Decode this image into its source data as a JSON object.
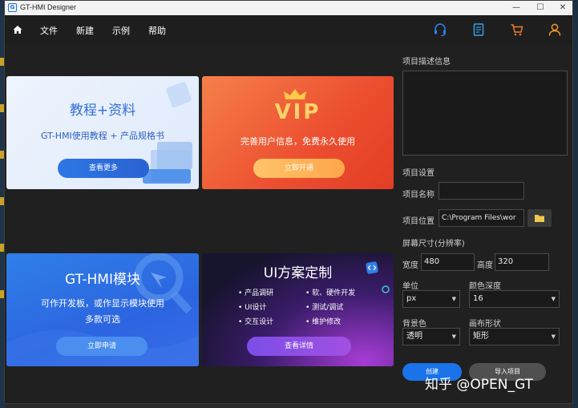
{
  "window": {
    "title": "GT-HMI Designer",
    "logo_text": "G"
  },
  "window_controls": {
    "minimize": "—",
    "maximize": "☐",
    "close": "✕"
  },
  "menu": {
    "home_icon": "home-icon",
    "items": [
      "文件",
      "新建",
      "示例",
      "帮助"
    ]
  },
  "toolbar_icons": [
    "headset-icon",
    "document-icon",
    "cart-icon",
    "user-icon"
  ],
  "cards": {
    "tutorial": {
      "title": "教程+资料",
      "subtitle": "GT-HMI使用教程 + 产品规格书",
      "button": "查看更多"
    },
    "vip": {
      "logo": "VIP",
      "subtitle": "完善用户信息，免费永久使用",
      "button": "立即开通"
    },
    "module": {
      "title": "GT-HMI模块",
      "subtitle_1": "可作开发板，或作显示模块使用",
      "subtitle_2": "多款可选",
      "button": "立即申请"
    },
    "custom": {
      "title": "UI方案定制",
      "bullets": [
        "• 产品调研",
        "• 软、硬件开发",
        "• UI设计",
        "• 测试/调试",
        "• 交互设计",
        "• 维护修改"
      ],
      "button": "查看详情"
    }
  },
  "panel": {
    "desc_label": "项目描述信息",
    "desc_value": "",
    "settings_label": "项目设置",
    "name_label": "项目名称",
    "name_value": "",
    "location_label": "项目位置",
    "location_value": "C:\\Program Files\\wor",
    "folder_icon": "folder-icon",
    "screen_label": "屏幕尺寸(分辨率)",
    "width_label": "宽度",
    "width_value": "480",
    "height_label": "高度",
    "height_value": "320",
    "unit_label": "单位",
    "unit_value": "px",
    "depth_label": "颜色深度",
    "depth_value": "16",
    "bg_label": "背景色",
    "bg_value": "透明",
    "shape_label": "画布形状",
    "shape_value": "矩形",
    "create_button": "创建",
    "import_button": "导入项目"
  },
  "watermark": "知乎 @OPEN_GT",
  "colors": {
    "accent_blue": "#1a73e8",
    "orange": "#f07a3a",
    "window_bg": "#202020"
  }
}
